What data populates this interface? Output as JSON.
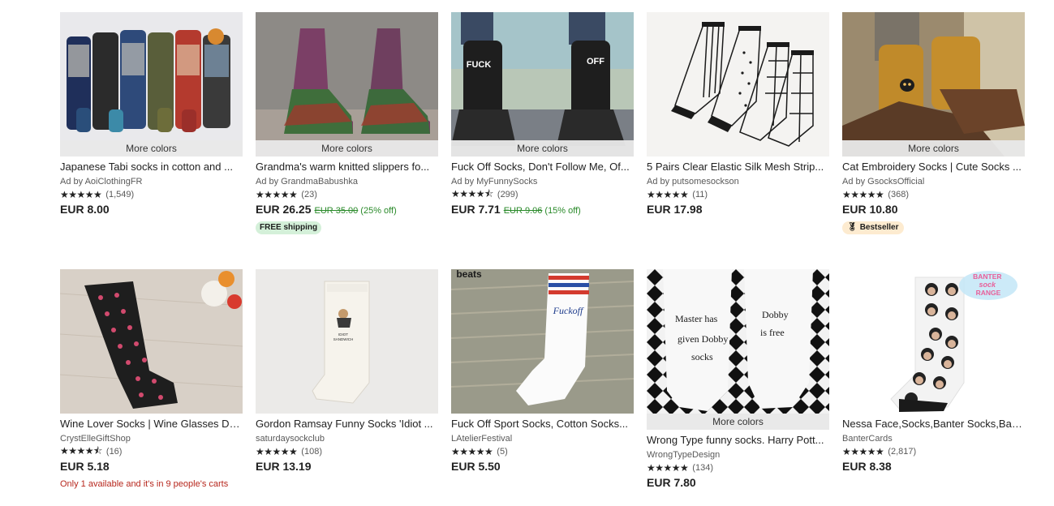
{
  "listings": [
    {
      "title": "Japanese Tabi socks in cotton and ...",
      "shop": "Ad by AoiClothingFR",
      "stars": "★★★★★",
      "reviews": "(1,549)",
      "price": "EUR 8.00",
      "more_colors": "More colors"
    },
    {
      "title": "Grandma's warm knitted slippers fo...",
      "shop": "Ad by GrandmaBabushka",
      "stars": "★★★★★",
      "reviews": "(23)",
      "price": "EUR 26.25",
      "original_price": "EUR 35.00",
      "discount": "(25% off)",
      "badge": "FREE shipping",
      "more_colors": "More colors"
    },
    {
      "title": "Fuck Off Socks, Don't Follow Me, Of...",
      "shop": "Ad by MyFunnySocks",
      "stars": "★★★★⯪",
      "reviews": "(299)",
      "price": "EUR 7.71",
      "original_price": "EUR 9.06",
      "discount": "(15% off)",
      "more_colors": "More colors",
      "image_text_left": "FUCK",
      "image_text_right": "OFF"
    },
    {
      "title": "5 Pairs Clear Elastic Silk Mesh Strip...",
      "shop": "Ad by putsomesockson",
      "stars": "★★★★★",
      "reviews": "(11)",
      "price": "EUR 17.98"
    },
    {
      "title": "Cat Embroidery Socks | Cute Socks ...",
      "shop": "Ad by GsocksOfficial",
      "stars": "★★★★★",
      "reviews": "(368)",
      "price": "EUR 10.80",
      "badge": "Bestseller",
      "more_colors": "More colors"
    },
    {
      "title": "Wine Lover Socks | Wine Glasses De...",
      "shop": "CrystElleGiftShop",
      "stars": "★★★★⯪",
      "reviews": "(16)",
      "price": "EUR 5.18",
      "stock_note": "Only 1 available and it's in 9 people's carts"
    },
    {
      "title": "Gordon Ramsay Funny Socks 'Idiot ...",
      "shop": "saturdaysockclub",
      "stars": "★★★★★",
      "reviews": "(108)",
      "price": "EUR 13.19",
      "image_text": "IDIOT SANDWICH"
    },
    {
      "title": "Fuck Off Sport Socks, Cotton Socks...",
      "shop": "LAtelierFestival",
      "stars": "★★★★★",
      "reviews": "(5)",
      "price": "EUR 5.50",
      "image_text": "Fuckoff",
      "image_corner_text": "beats"
    },
    {
      "title": "Wrong Type funny socks. Harry Pott...",
      "shop": "WrongTypeDesign",
      "stars": "★★★★★",
      "reviews": "(134)",
      "price": "EUR 7.80",
      "more_colors": "More colors",
      "image_text_left": "Master has given Dobby socks",
      "image_text_right": "Dobby is free"
    },
    {
      "title": "Nessa Face,Socks,Banter Socks,Ban...",
      "shop": "BanterCards",
      "stars": "★★★★★",
      "reviews": "(2,817)",
      "price": "EUR 8.38",
      "image_logo": "BANTER SOCK RANGE"
    }
  ],
  "colors": {
    "discount_green": "#2a8a2a",
    "free_shipping_bg": "#d4f0d9",
    "bestseller_bg": "#fdebd0",
    "stock_red": "#b7271d"
  }
}
